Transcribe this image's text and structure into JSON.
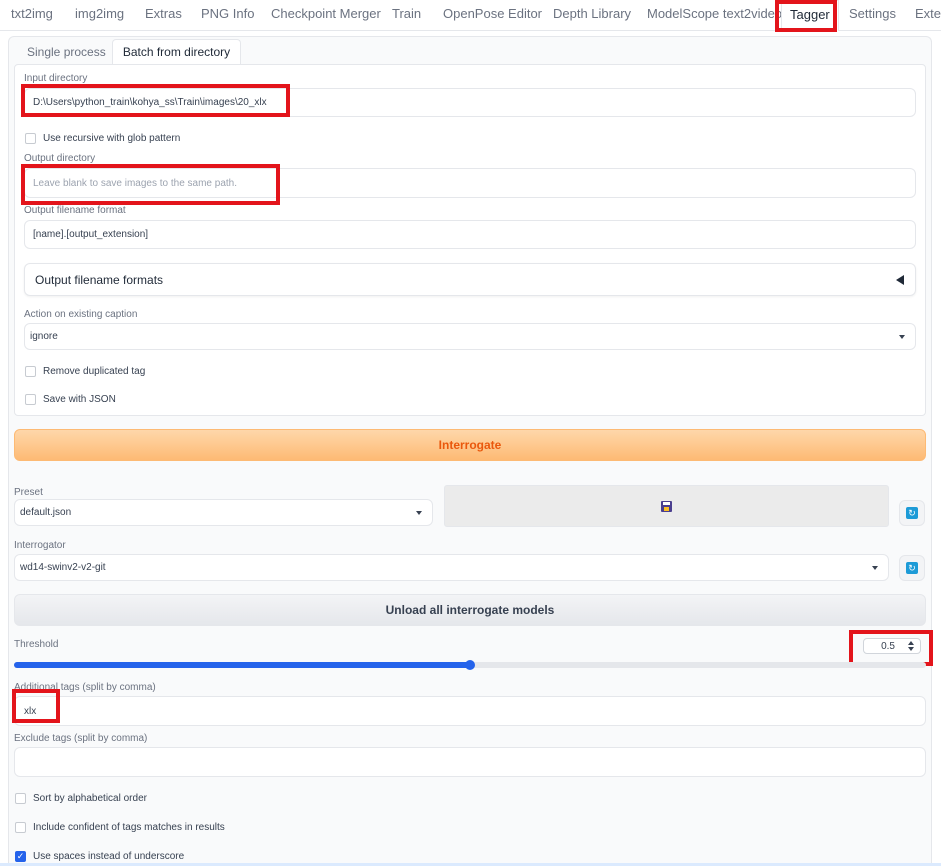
{
  "top_tabs": [
    {
      "label": "txt2img"
    },
    {
      "label": "img2img"
    },
    {
      "label": "Extras"
    },
    {
      "label": "PNG Info"
    },
    {
      "label": "Checkpoint Merger"
    },
    {
      "label": "Train"
    },
    {
      "label": "OpenPose Editor"
    },
    {
      "label": "Depth Library"
    },
    {
      "label": "ModelScope text2video"
    },
    {
      "label": "Tagger"
    },
    {
      "label": "Settings"
    },
    {
      "label": "Exter"
    }
  ],
  "sub_tabs": {
    "single": "Single process",
    "batch": "Batch from directory"
  },
  "batch": {
    "input_label": "Input directory",
    "input_value": "D:\\Users\\python_train\\kohya_ss\\Train\\images\\20_xlx",
    "recursive_label": "Use recursive with glob pattern",
    "output_label": "Output directory",
    "output_placeholder": "Leave blank to save images to the same path.",
    "filename_format_label": "Output filename format",
    "filename_format_value": "[name].[output_extension]",
    "formats_accordion": "Output filename formats",
    "action_label": "Action on existing caption",
    "action_value": "ignore",
    "remove_dup_label": "Remove duplicated tag",
    "save_json_label": "Save with JSON"
  },
  "interrogate_label": "Interrogate",
  "preset": {
    "label": "Preset",
    "value": "default.json",
    "save_icon": "floppy-disk"
  },
  "interrogator": {
    "label": "Interrogator",
    "value": "wd14-swinv2-v2-git"
  },
  "unload_label": "Unload all interrogate models",
  "threshold": {
    "label": "Threshold",
    "value": "0.5",
    "fraction": 0.5
  },
  "additional_tags": {
    "label": "Additional tags (split by comma)",
    "value": "xlx"
  },
  "exclude_tags": {
    "label": "Exclude tags (split by comma)",
    "value": ""
  },
  "options": {
    "sort_label": "Sort by alphabetical order",
    "include_label": "Include confident of tags matches in results",
    "spaces_label": "Use spaces instead of underscore"
  },
  "colors": {
    "accent": "#f97316",
    "highlight": "#e3141b",
    "slider": "#2563eb",
    "refresh_icon": "#1d9bd7"
  }
}
